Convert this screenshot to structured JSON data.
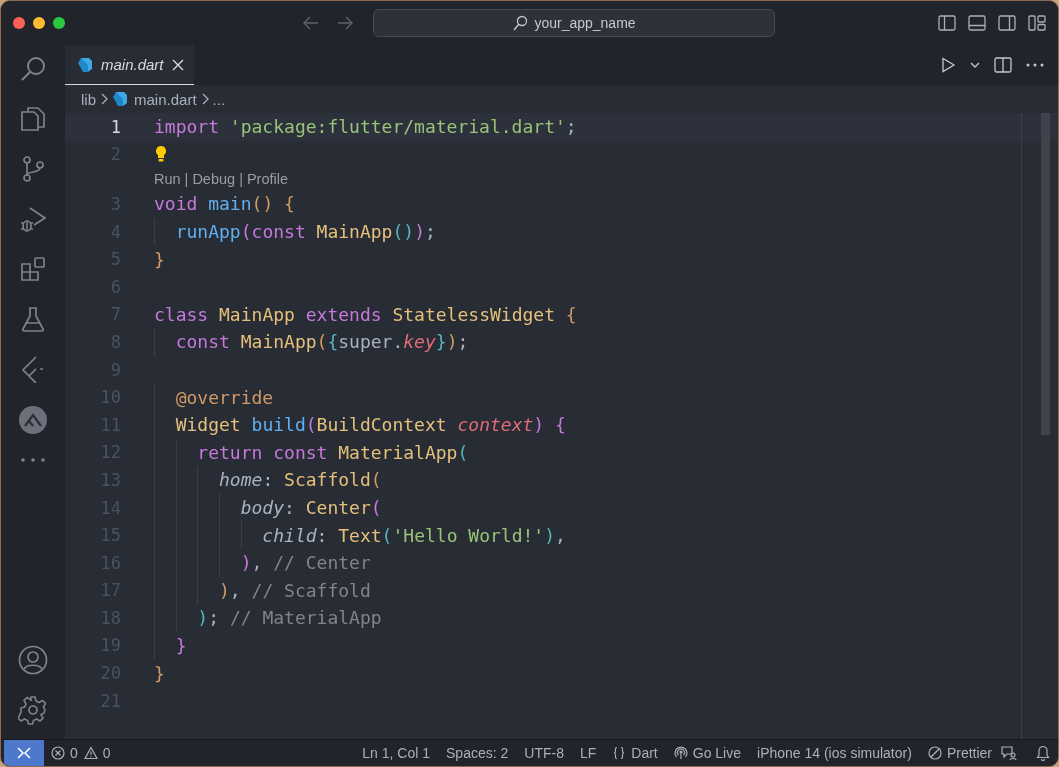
{
  "title_bar": {
    "search": {
      "value": "your_app_name"
    }
  },
  "tabs": [
    {
      "label": "main.dart",
      "selected": true,
      "preview": true
    }
  ],
  "breadcrumb": [
    {
      "text": "lib",
      "kind": "folder"
    },
    {
      "text": "main.dart",
      "kind": "file"
    },
    {
      "text": "...",
      "kind": "more"
    }
  ],
  "editor": {
    "lines": [
      {
        "kind": "code",
        "number": "1",
        "selected": true,
        "tokens": [
          {
            "text": "import ",
            "kind": "keyword"
          },
          {
            "text": "'package:flutter/material.dart'",
            "kind": "string"
          },
          {
            "text": ";",
            "kind": "plain"
          }
        ]
      },
      {
        "kind": "code",
        "number": "2",
        "selected": false,
        "lightbulb": true
      },
      {
        "kind": "codelens",
        "links": [
          "Run",
          "Debug",
          "Profile"
        ],
        "separator": "|"
      },
      {
        "kind": "code",
        "number": "3",
        "selected": false,
        "tokens": [
          {
            "text": "void ",
            "kind": "keyword"
          },
          {
            "text": "main",
            "kind": "function"
          },
          {
            "text": "() ",
            "kind": "bracket1"
          },
          {
            "text": "{",
            "kind": "bracket1"
          }
        ]
      },
      {
        "kind": "code",
        "number": "4",
        "selected": false,
        "tokens": [
          {
            "text": "  runApp",
            "kind": "function"
          },
          {
            "text": "(",
            "kind": "bracket2"
          },
          {
            "text": "const ",
            "kind": "keyword"
          },
          {
            "text": "MainApp",
            "kind": "class"
          },
          {
            "text": "()",
            "kind": "bracket3"
          },
          {
            "text": ")",
            "kind": "bracket2"
          },
          {
            "text": ";",
            "kind": "plain"
          }
        ]
      },
      {
        "kind": "code",
        "number": "5",
        "selected": false,
        "tokens": [
          {
            "text": "}",
            "kind": "bracket1"
          }
        ]
      },
      {
        "kind": "code",
        "number": "6",
        "selected": false
      },
      {
        "kind": "code",
        "number": "7",
        "selected": false,
        "tokens": [
          {
            "text": "class ",
            "kind": "keyword"
          },
          {
            "text": "MainApp ",
            "kind": "class"
          },
          {
            "text": "extends ",
            "kind": "keyword"
          },
          {
            "text": "StatelessWidget ",
            "kind": "class"
          },
          {
            "text": "{",
            "kind": "bracket1"
          }
        ]
      },
      {
        "kind": "code",
        "number": "8",
        "selected": false,
        "tokens": [
          {
            "text": "  const ",
            "kind": "keyword"
          },
          {
            "text": "MainApp",
            "kind": "class"
          },
          {
            "text": "(",
            "kind": "bracket1"
          },
          {
            "text": "{",
            "kind": "bracket3"
          },
          {
            "text": "super.",
            "kind": "plain"
          },
          {
            "text": "key",
            "kind": "param"
          },
          {
            "text": "}",
            "kind": "bracket3"
          },
          {
            "text": ")",
            "kind": "bracket1"
          },
          {
            "text": ";",
            "kind": "plain"
          }
        ]
      },
      {
        "kind": "code",
        "number": "9",
        "selected": false
      },
      {
        "kind": "code",
        "number": "10",
        "selected": false,
        "tokens": [
          {
            "text": "  @override",
            "kind": "annotation"
          }
        ]
      },
      {
        "kind": "code",
        "number": "11",
        "selected": false,
        "tokens": [
          {
            "text": "  Widget ",
            "kind": "class"
          },
          {
            "text": "build",
            "kind": "function"
          },
          {
            "text": "(",
            "kind": "bracket2"
          },
          {
            "text": "BuildContext ",
            "kind": "class"
          },
          {
            "text": "context",
            "kind": "param"
          },
          {
            "text": ") ",
            "kind": "bracket2"
          },
          {
            "text": "{",
            "kind": "bracket2"
          }
        ]
      },
      {
        "kind": "code",
        "number": "12",
        "selected": false,
        "tokens": [
          {
            "text": "    return const ",
            "kind": "keyword"
          },
          {
            "text": "MaterialApp",
            "kind": "class"
          },
          {
            "text": "(",
            "kind": "bracket3"
          }
        ]
      },
      {
        "kind": "code",
        "number": "13",
        "selected": false,
        "tokens": [
          {
            "text": "      home",
            "kind": "named"
          },
          {
            "text": ": ",
            "kind": "plain"
          },
          {
            "text": "Scaffold",
            "kind": "class"
          },
          {
            "text": "(",
            "kind": "bracket1"
          }
        ]
      },
      {
        "kind": "code",
        "number": "14",
        "selected": false,
        "tokens": [
          {
            "text": "        body",
            "kind": "named"
          },
          {
            "text": ": ",
            "kind": "plain"
          },
          {
            "text": "Center",
            "kind": "class"
          },
          {
            "text": "(",
            "kind": "bracket2"
          }
        ]
      },
      {
        "kind": "code",
        "number": "15",
        "selected": false,
        "tokens": [
          {
            "text": "          child",
            "kind": "named"
          },
          {
            "text": ": ",
            "kind": "plain"
          },
          {
            "text": "Text",
            "kind": "class"
          },
          {
            "text": "(",
            "kind": "bracket3"
          },
          {
            "text": "'Hello World!'",
            "kind": "string"
          },
          {
            "text": ")",
            "kind": "bracket3"
          },
          {
            "text": ",",
            "kind": "plain"
          }
        ]
      },
      {
        "kind": "code",
        "number": "16",
        "selected": false,
        "tokens": [
          {
            "text": "        )",
            "kind": "bracket2"
          },
          {
            "text": ", ",
            "kind": "plain"
          },
          {
            "text": "// Center",
            "kind": "comment"
          }
        ]
      },
      {
        "kind": "code",
        "number": "17",
        "selected": false,
        "tokens": [
          {
            "text": "      )",
            "kind": "bracket1"
          },
          {
            "text": ", ",
            "kind": "plain"
          },
          {
            "text": "// Scaffold",
            "kind": "comment"
          }
        ]
      },
      {
        "kind": "code",
        "number": "18",
        "selected": false,
        "tokens": [
          {
            "text": "    )",
            "kind": "bracket3"
          },
          {
            "text": "; ",
            "kind": "plain"
          },
          {
            "text": "// MaterialApp",
            "kind": "comment"
          }
        ]
      },
      {
        "kind": "code",
        "number": "19",
        "selected": false,
        "tokens": [
          {
            "text": "  }",
            "kind": "bracket2"
          }
        ]
      },
      {
        "kind": "code",
        "number": "20",
        "selected": false,
        "tokens": [
          {
            "text": "}",
            "kind": "bracket1"
          }
        ]
      },
      {
        "kind": "code",
        "number": "21",
        "selected": false
      }
    ]
  },
  "status_bar": {
    "left": [
      {
        "text": "0",
        "kind": "errors"
      },
      {
        "text": "0",
        "kind": "warnings"
      }
    ],
    "right": [
      {
        "text": "Ln 1, Col 1",
        "kind": "text"
      },
      {
        "text": "Spaces: 2",
        "kind": "text"
      },
      {
        "text": "UTF-8",
        "kind": "text"
      },
      {
        "text": "LF",
        "kind": "text"
      },
      {
        "text": "Dart",
        "kind": "language"
      },
      {
        "text": "Go Live",
        "kind": "live"
      },
      {
        "text": "iPhone 14 (ios simulator)",
        "kind": "text"
      },
      {
        "text": "Prettier",
        "kind": "formatter"
      }
    ]
  }
}
